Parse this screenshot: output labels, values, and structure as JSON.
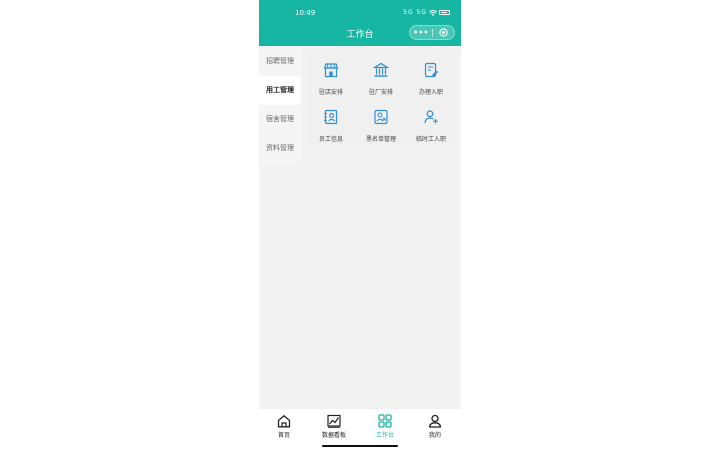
{
  "status_bar": {
    "time": "10:49",
    "signal": "5G 5G",
    "wifi": "WiFi",
    "battery": "battery"
  },
  "header": {
    "title": "工作台",
    "more": "•••",
    "close_icon": "target-circle-icon"
  },
  "colors": {
    "primary": "#16b6a2",
    "background": "#f2f2f2"
  },
  "sidebar": {
    "items": [
      {
        "label": "招聘管理",
        "active": false
      },
      {
        "label": "用工管理",
        "active": true
      },
      {
        "label": "宿舍管理",
        "active": false
      },
      {
        "label": "资料管理",
        "active": false
      }
    ]
  },
  "grid": {
    "items": [
      {
        "label": "驻店安排",
        "icon": "store-icon"
      },
      {
        "label": "驻厂安排",
        "icon": "bank-building-icon"
      },
      {
        "label": "办理入职",
        "icon": "document-edit-icon"
      },
      {
        "label": "员工信息",
        "icon": "contact-card-icon"
      },
      {
        "label": "黑名单管理",
        "icon": "blacklist-user-icon"
      },
      {
        "label": "临时工入职",
        "icon": "user-add-icon"
      }
    ]
  },
  "bottom_nav": {
    "items": [
      {
        "label": "首页",
        "icon": "home-icon",
        "active": false
      },
      {
        "label": "数据看板",
        "icon": "chart-icon",
        "active": false
      },
      {
        "label": "工作台",
        "icon": "grid-icon",
        "active": true
      },
      {
        "label": "我的",
        "icon": "person-icon",
        "active": false
      }
    ]
  }
}
